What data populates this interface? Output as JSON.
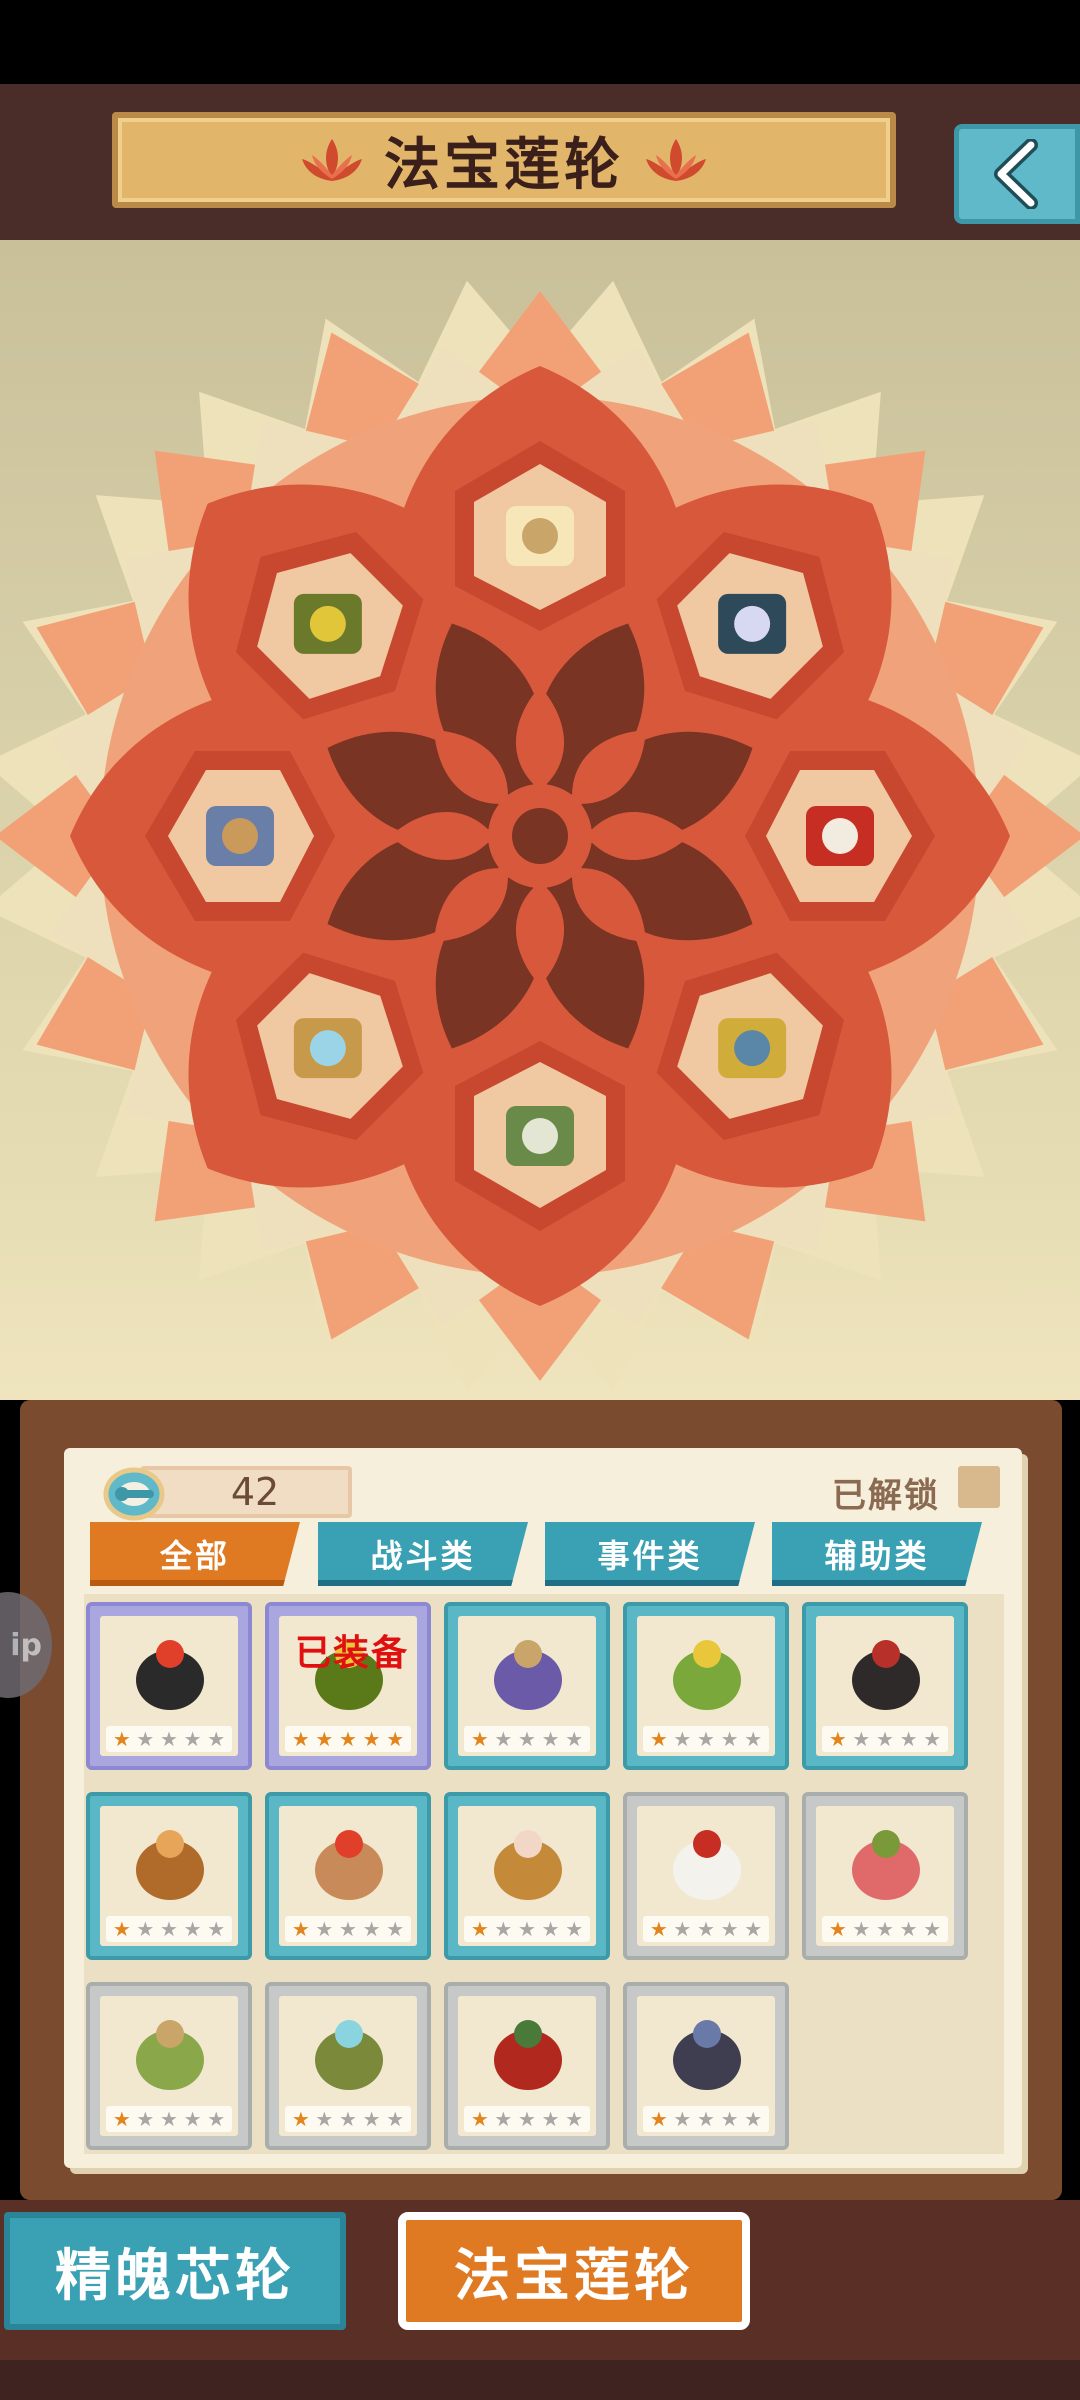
{
  "header": {
    "title": "法宝莲轮",
    "back_icon": "chevron-left-icon"
  },
  "wheel": {
    "slots": [
      {
        "name": "scroll-book"
      },
      {
        "name": "jade-crescent"
      },
      {
        "name": "red-gourd"
      },
      {
        "name": "spiked-mace"
      },
      {
        "name": "green-owl"
      },
      {
        "name": "wooden-staff"
      },
      {
        "name": "crescent-spear"
      },
      {
        "name": "golden-herb"
      }
    ]
  },
  "panel": {
    "currency_icon": "key-coin-icon",
    "currency_value": "42",
    "unlocked_label": "已解锁",
    "tabs": [
      {
        "label": "全部",
        "active": true
      },
      {
        "label": "战斗类",
        "active": false
      },
      {
        "label": "事件类",
        "active": false
      },
      {
        "label": "辅助类",
        "active": false
      }
    ],
    "equipped_label": "已装备",
    "items": [
      {
        "name": "flame-lamp",
        "rarity": "purple",
        "stars": 1
      },
      {
        "name": "golden-herb",
        "rarity": "purple",
        "stars": 5,
        "equipped": true
      },
      {
        "name": "purple-orbs",
        "rarity": "blue",
        "stars": 1
      },
      {
        "name": "green-gourd",
        "rarity": "blue",
        "stars": 1
      },
      {
        "name": "dark-sword",
        "rarity": "blue",
        "stars": 1
      },
      {
        "name": "prayer-beads",
        "rarity": "blue",
        "stars": 1
      },
      {
        "name": "fire-claw",
        "rarity": "blue",
        "stars": 1
      },
      {
        "name": "lotus-seed",
        "rarity": "blue",
        "stars": 1
      },
      {
        "name": "white-vase",
        "rarity": "gray",
        "stars": 1
      },
      {
        "name": "plum-blossom",
        "rarity": "gray",
        "stars": 1
      },
      {
        "name": "green-balls",
        "rarity": "gray",
        "stars": 1
      },
      {
        "name": "water-bowl",
        "rarity": "gray",
        "stars": 1
      },
      {
        "name": "red-fruit",
        "rarity": "gray",
        "stars": 1
      },
      {
        "name": "dark-ore",
        "rarity": "gray",
        "stars": 1
      }
    ]
  },
  "help_button": {
    "label": "ip"
  },
  "bottom_tabs": [
    {
      "label": "精魄芯轮",
      "active": false
    },
    {
      "label": "法宝莲轮",
      "active": true
    }
  ],
  "colors": {
    "header_bg": "#4a2c28",
    "banner": "#e2b66a",
    "accent_orange": "#e07a22",
    "accent_teal": "#3aa0b4",
    "mandala_main": "#d8583c",
    "mandala_dark": "#7a3424"
  }
}
